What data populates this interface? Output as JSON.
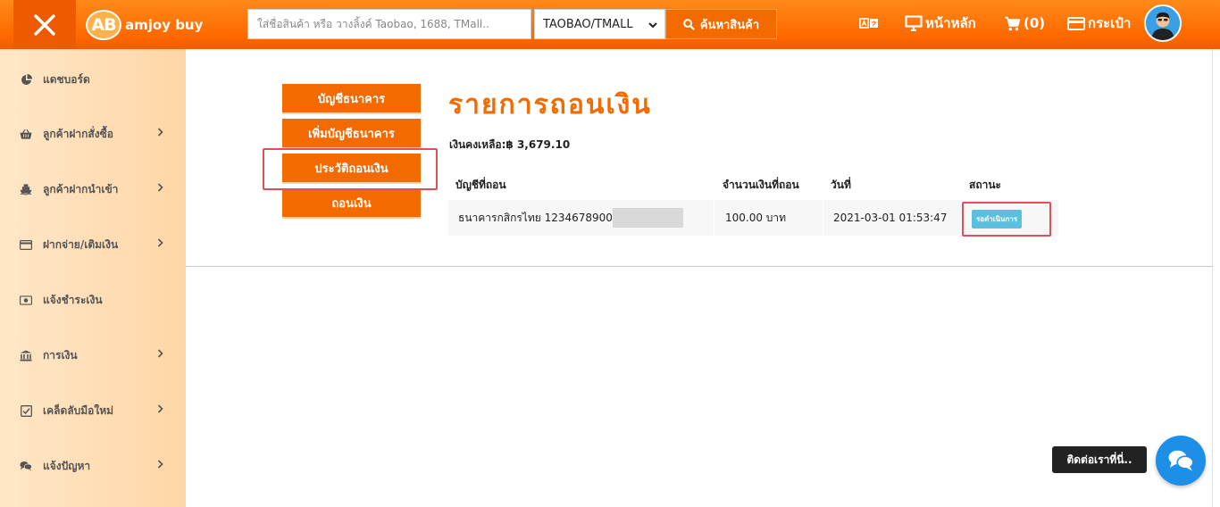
{
  "header": {
    "logo_abbr": "AB",
    "logo_text": "amjoy buy",
    "search_placeholder": "ใส่ชื่อสินค้า หรือ วางลิ้งค์ Taobao, 1688, TMall..",
    "platform_selected": "TAOBAO/TMALL",
    "search_button": "ค้นหาสินค้า",
    "nav": {
      "home": "หน้าหลัก",
      "cart": "(0)",
      "wallet": "กระเป๋า"
    }
  },
  "sidebar": {
    "items": [
      {
        "label": "แดชบอร์ด",
        "icon": "pie-chart-icon",
        "has_children": false
      },
      {
        "label": "ลูกค้าฝากสั่งซื้อ",
        "icon": "basket-icon",
        "has_children": true
      },
      {
        "label": "ลูกค้าฝากนำเข้า",
        "icon": "ship-icon",
        "has_children": true
      },
      {
        "label": "ฝากจ่าย/เติมเงิน",
        "icon": "credit-card-icon",
        "has_children": true
      },
      {
        "label": "แจ้งชำระเงิน",
        "icon": "money-bill-icon",
        "has_children": false
      },
      {
        "label": "การเงิน",
        "icon": "bank-icon",
        "has_children": true
      },
      {
        "label": "เคล็ดลับมือใหม่",
        "icon": "checkbox-icon",
        "has_children": true
      },
      {
        "label": "แจ้งปัญหา",
        "icon": "chat-bubbles-icon",
        "has_children": true
      }
    ]
  },
  "account_menu": {
    "items": [
      "บัญชีธนาคาร",
      "เพิ่มบัญชีธนาคาร",
      "ประวัติถอนเงิน",
      "ถอนเงิน"
    ],
    "active_index": 2
  },
  "main": {
    "title": "รายการถอนเงิน",
    "balance_label": "เงินคงเหลือ:",
    "balance_value": "฿ 3,679.10",
    "table": {
      "columns": [
        "บัญชีที่ถอน",
        "จำนวนเงินที่ถอน",
        "วันที่",
        "สถานะ"
      ],
      "rows": [
        {
          "account": "ธนาคารกสิกรไทย 1234678900 ค",
          "amount": "100.00 บาท",
          "date": "2021-03-01 01:53:47",
          "status": "รอดำเนินการ"
        }
      ]
    }
  },
  "chat": {
    "label": "ติดต่อเราที่นี่.."
  },
  "colors": {
    "brand_orange": "#f26a00",
    "sidebar_bg": "#ffe0b8",
    "status_info": "#5bc0de",
    "highlight_red": "#e0505a",
    "chat_blue": "#1e8fe6"
  }
}
